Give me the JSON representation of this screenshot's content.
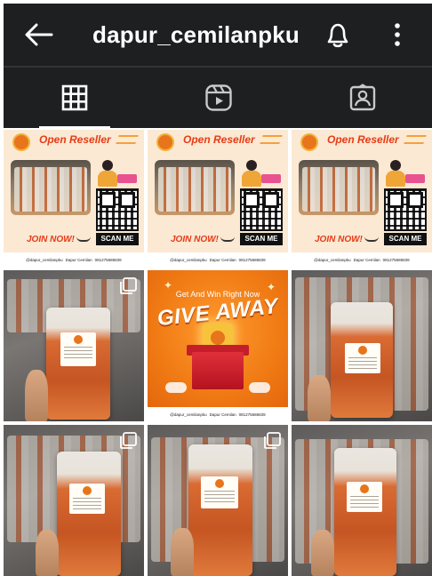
{
  "header": {
    "title": "dapur_cemilanpku",
    "back_icon": "arrow-left-icon",
    "notify_icon": "bell-icon",
    "more_icon": "more-vertical-icon",
    "background": "#1e1f21"
  },
  "tabs": [
    {
      "name": "posts",
      "icon": "grid-icon",
      "active": true
    },
    {
      "name": "reels",
      "icon": "reels-icon",
      "active": false
    },
    {
      "name": "tagged",
      "icon": "tagged-person-icon",
      "active": false
    }
  ],
  "posts": {
    "reseller": {
      "title": "Open Reseller",
      "join": "JOIN NOW!",
      "scan": "SCAN ME",
      "footer_ig": "@dapur_cemilanpku",
      "footer_fb": "Dapur Cemilan",
      "footer_wa": "081275686839"
    },
    "giveaway": {
      "subtitle": "Get And Win Right Now",
      "title": "GIVE AWAY",
      "footer_ig": "@dapur_cemilanpku",
      "footer_fb": "Dapur Cemilan",
      "footer_wa": "081275686839"
    }
  },
  "colors": {
    "accent_red": "#e63b17",
    "accent_orange": "#f07a14",
    "reseller_bg": "#fbe9d3"
  }
}
